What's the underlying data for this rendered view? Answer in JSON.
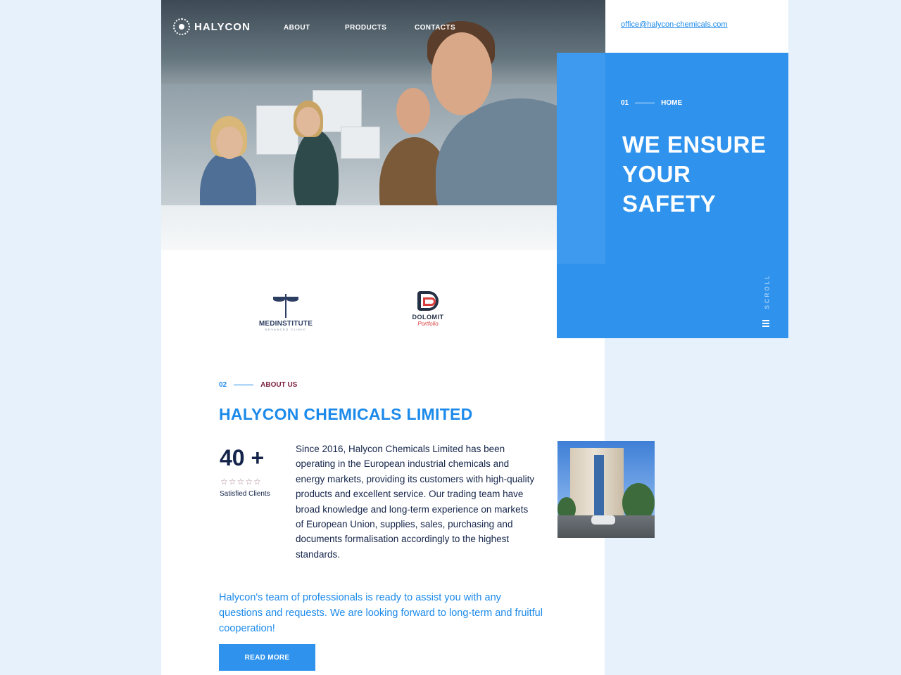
{
  "header": {
    "brand": "HALYCON",
    "nav": [
      "ABOUT",
      "PRODUCTS",
      "CONTACTS"
    ],
    "email": "office@halycon-chemicals.com"
  },
  "hero": {
    "section_number": "01",
    "section_label": "HOME",
    "title": "WE ENSURE YOUR SAFETY",
    "scroll_label": "SCROLL"
  },
  "partners": [
    {
      "name": "MEDINSTITUTE",
      "sub": "ADVANCED CLINIC"
    },
    {
      "name": "DOLOMIT",
      "sub": "Portfolio"
    }
  ],
  "about": {
    "section_number": "02",
    "section_label": "ABOUT US",
    "title": "HALYCON CHEMICALS LIMITED",
    "stat_value": "40 +",
    "stars": "☆☆☆☆☆",
    "stat_label": "Satisfied Clients",
    "body": "Since 2016, Halycon Chemicals Limited has been operating in the European industrial chemicals and energy markets, providing its customers with high-quality products and excellent service. Our trading team have broad knowledge and long-term experience on markets of European Union, supplies, sales, purchasing and documents formalisation accordingly to the highest standards.",
    "cta_text": "Halycon's team of professionals is ready to assist you with any questions and requests. We are looking forward to long-term and fruitful cooperation!",
    "button_label": "READ MORE"
  },
  "colors": {
    "accent": "#2f93ee",
    "link": "#1c8aea",
    "navy": "#14244a",
    "maroon": "#7a1f3d",
    "background": "#e6f1fc"
  }
}
